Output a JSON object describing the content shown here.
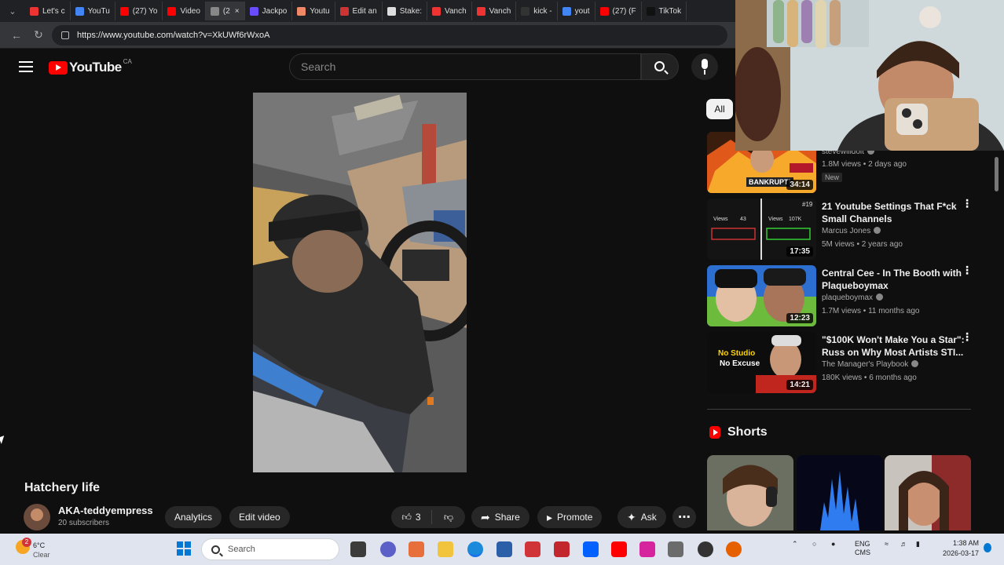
{
  "browser": {
    "tabs": [
      {
        "label": "Let's c",
        "color": "#e33"
      },
      {
        "label": "YouTu",
        "color": "#4285f4"
      },
      {
        "label": "(27) Yo",
        "color": "#f00"
      },
      {
        "label": "Video",
        "color": "#f00"
      },
      {
        "label": "(2",
        "color": "#888"
      },
      {
        "label": "Jackpo",
        "color": "#6a4cff"
      },
      {
        "label": "Youtu",
        "color": "#e86"
      },
      {
        "label": "Edit an",
        "color": "#c33"
      },
      {
        "label": "Stake:",
        "color": "#ddd"
      },
      {
        "label": "Vanch",
        "color": "#e33"
      },
      {
        "label": "Vanch",
        "color": "#e33"
      },
      {
        "label": "kick -",
        "color": "#333"
      },
      {
        "label": "yout",
        "color": "#4285f4"
      },
      {
        "label": "(27) (F",
        "color": "#f00"
      },
      {
        "label": "TikTok",
        "color": "#111"
      }
    ],
    "url": "https://www.youtube.com/watch?v=XkUWf6rWxoA"
  },
  "youtube": {
    "logo_text": "YouTube",
    "country_code": "CA",
    "search_placeholder": "Search",
    "video_title": "Hatchery life",
    "channel_name": "AKA-teddyempress",
    "subscribers": "20 subscribers",
    "buttons": {
      "analytics": "Analytics",
      "edit_video": "Edit video",
      "likes": "3",
      "share": "Share",
      "promote": "Promote",
      "ask": "Ask"
    },
    "chip_all": "All",
    "recommendations": [
      {
        "title": "",
        "channel": "stevewilldoit",
        "meta": "1.8M views • 2 days ago",
        "badge": "New",
        "duration": "34:14"
      },
      {
        "title": "21 Youtube Settings That F*ck Small Channels",
        "channel": "Marcus Jones",
        "meta": "5M views • 2 years ago",
        "duration": "17:35"
      },
      {
        "title": "Central Cee - In The Booth with Plaqueboymax",
        "channel": "plaqueboymax",
        "meta": "1.7M views • 11 months ago",
        "duration": "12:23"
      },
      {
        "title": "\"$100K Won't Make You a Star\": Russ on Why Most Artists STI...",
        "channel": "The Manager's Playbook",
        "meta": "180K views • 6 months ago",
        "duration": "14:21"
      }
    ],
    "thumb_text": {
      "bankrupt": "BANKRUPT!",
      "views_label": "Views",
      "views_a": "43",
      "views_b": "107K",
      "rank": "#19",
      "no_studio": "No Studio",
      "no_excuse": "No Excuse"
    },
    "shorts_label": "Shorts"
  },
  "taskbar": {
    "weather_temp": "6°C",
    "weather_cond": "Clear",
    "weather_badge": "2",
    "search_placeholder": "Search",
    "lang_1": "ENG",
    "lang_2": "CMS",
    "time": "1:38 AM",
    "date": "2026-03-17"
  }
}
